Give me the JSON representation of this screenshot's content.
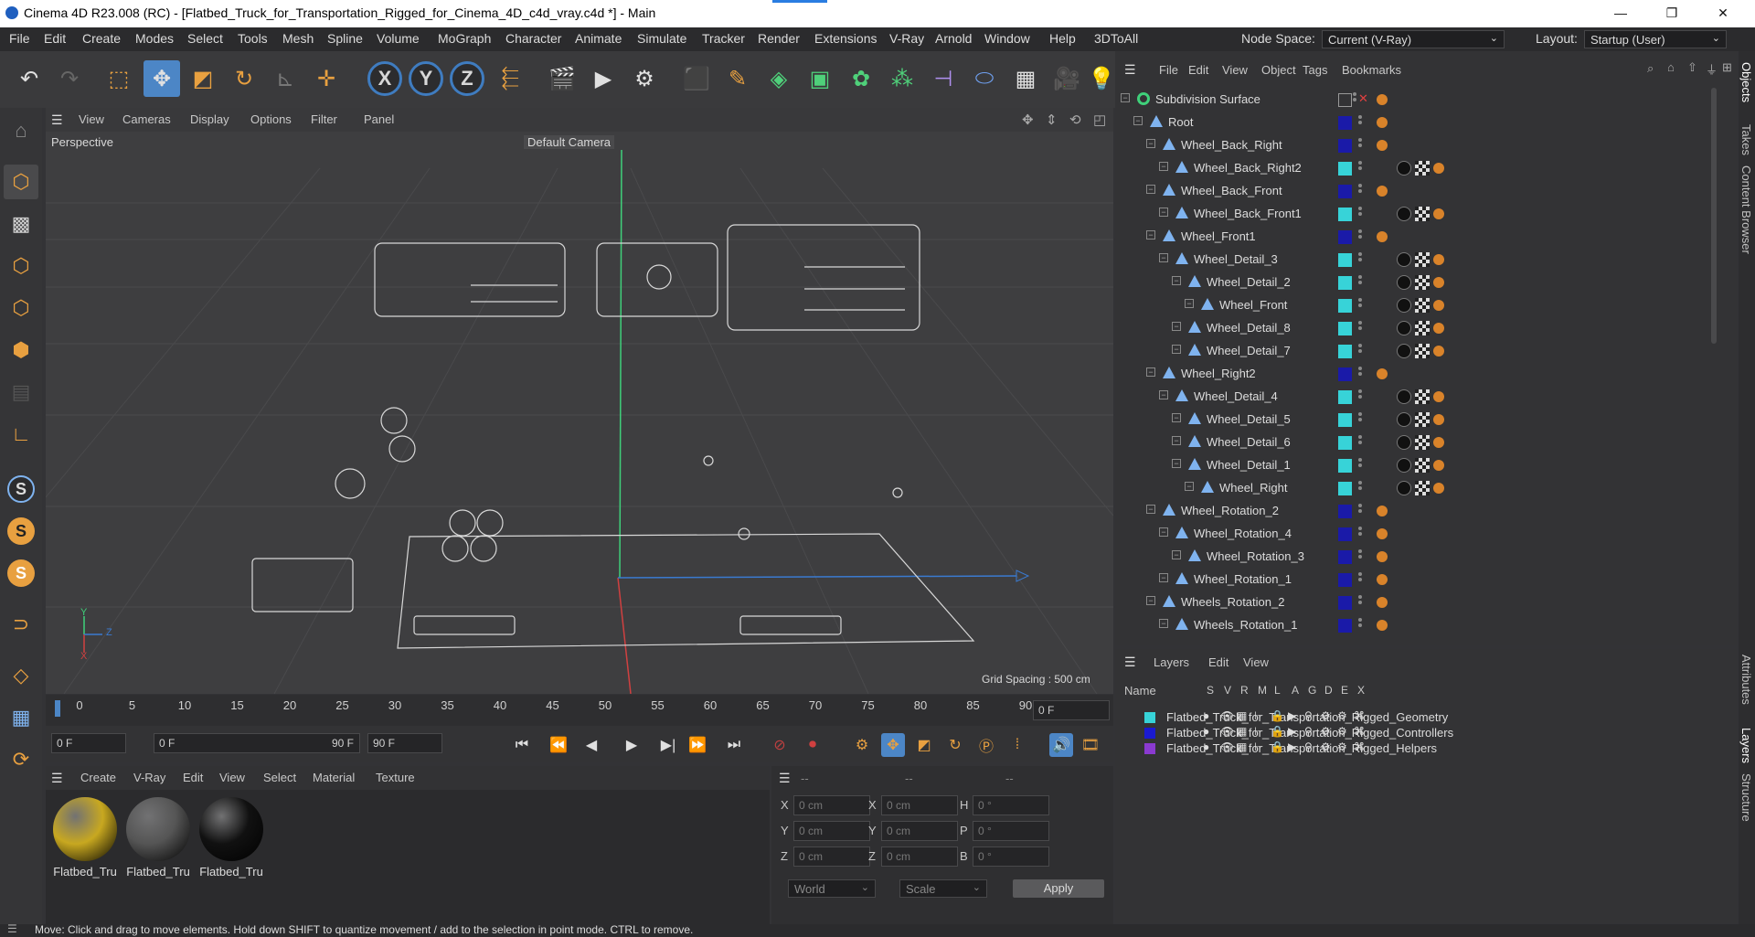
{
  "window": {
    "title": "Cinema 4D R23.008 (RC) - [Flatbed_Truck_for_Transportation_Rigged_for_Cinema_4D_c4d_vray.c4d *] - Main",
    "minimize": "—",
    "restore": "❐",
    "close": "✕"
  },
  "menubar": {
    "items": [
      "File",
      "Edit",
      "Create",
      "Modes",
      "Select",
      "Tools",
      "Mesh",
      "Spline",
      "Volume",
      "MoGraph",
      "Character",
      "Animate",
      "Simulate",
      "Tracker",
      "Render",
      "Extensions",
      "V-Ray",
      "Arnold",
      "Window",
      "Help",
      "3DToAll"
    ],
    "node_space_label": "Node Space:",
    "node_space_value": "Current (V-Ray)",
    "layout_label": "Layout:",
    "layout_value": "Startup (User)"
  },
  "viewport": {
    "menu": [
      "View",
      "Cameras",
      "Display",
      "Options",
      "Filter",
      "Panel"
    ],
    "view_name": "Perspective",
    "camera": "Default Camera",
    "grid_spacing": "Grid Spacing : 500 cm",
    "axis_y": "Y",
    "axis_z": "Z",
    "axis_x": "X"
  },
  "timeline": {
    "ticks": [
      "0",
      "5",
      "10",
      "15",
      "20",
      "25",
      "30",
      "35",
      "40",
      "45",
      "50",
      "55",
      "60",
      "65",
      "70",
      "75",
      "80",
      "85",
      "90"
    ],
    "current_frame": "0 F"
  },
  "transport": {
    "start": "0 F",
    "range_start": "0 F",
    "range_end": "90 F",
    "end": "90 F"
  },
  "materials": {
    "menu": [
      "Create",
      "V-Ray",
      "Edit",
      "View",
      "Select",
      "Material",
      "Texture"
    ],
    "items": [
      {
        "label": "Flatbed_Tru",
        "color": "#c8a820"
      },
      {
        "label": "Flatbed_Tru",
        "color": "#555555"
      },
      {
        "label": "Flatbed_Tru",
        "color": "#111111"
      }
    ]
  },
  "attributes": {
    "headers": [
      "--",
      "--",
      "--"
    ],
    "rows": [
      {
        "a": "X",
        "av": "0 cm",
        "b": "X",
        "bv": "0 cm",
        "c": "H",
        "cv": "0 °"
      },
      {
        "a": "Y",
        "av": "0 cm",
        "b": "Y",
        "bv": "0 cm",
        "c": "P",
        "cv": "0 °"
      },
      {
        "a": "Z",
        "av": "0 cm",
        "b": "Z",
        "bv": "0 cm",
        "c": "B",
        "cv": "0 °"
      }
    ],
    "coord_mode": "World",
    "scale_mode": "Scale",
    "apply": "Apply"
  },
  "status": "Move: Click and drag to move elements. Hold down SHIFT to quantize movement / add to the selection in point mode. CTRL to remove.",
  "objects": {
    "menu": [
      "File",
      "Edit",
      "View",
      "Object",
      "Tags",
      "Bookmarks"
    ],
    "rows": [
      {
        "name": "Subdivision Surface",
        "color": "",
        "depth": 0
      },
      {
        "name": "Root",
        "color": "#1a1aa8",
        "depth": 1
      },
      {
        "name": "Wheel_Back_Right",
        "color": "#1a1aa8",
        "depth": 2
      },
      {
        "name": "Wheel_Back_Right2",
        "color": "#37d3d8",
        "depth": 3
      },
      {
        "name": "Wheel_Back_Front",
        "color": "#1a1aa8",
        "depth": 2
      },
      {
        "name": "Wheel_Back_Front1",
        "color": "#37d3d8",
        "depth": 3
      },
      {
        "name": "Wheel_Front1",
        "color": "#1a1aa8",
        "depth": 2
      },
      {
        "name": "Wheel_Detail_3",
        "color": "#37d3d8",
        "depth": 3
      },
      {
        "name": "Wheel_Detail_2",
        "color": "#37d3d8",
        "depth": 4
      },
      {
        "name": "Wheel_Front",
        "color": "#37d3d8",
        "depth": 5
      },
      {
        "name": "Wheel_Detail_8",
        "color": "#37d3d8",
        "depth": 4
      },
      {
        "name": "Wheel_Detail_7",
        "color": "#37d3d8",
        "depth": 4
      },
      {
        "name": "Wheel_Right2",
        "color": "#1a1aa8",
        "depth": 2
      },
      {
        "name": "Wheel_Detail_4",
        "color": "#37d3d8",
        "depth": 3
      },
      {
        "name": "Wheel_Detail_5",
        "color": "#37d3d8",
        "depth": 4
      },
      {
        "name": "Wheel_Detail_6",
        "color": "#37d3d8",
        "depth": 4
      },
      {
        "name": "Wheel_Detail_1",
        "color": "#37d3d8",
        "depth": 4
      },
      {
        "name": "Wheel_Right",
        "color": "#37d3d8",
        "depth": 5
      },
      {
        "name": "Wheel_Rotation_2",
        "color": "#1a1aa8",
        "depth": 2
      },
      {
        "name": "Wheel_Rotation_4",
        "color": "#1a1aa8",
        "depth": 3
      },
      {
        "name": "Wheel_Rotation_3",
        "color": "#1a1aa8",
        "depth": 4
      },
      {
        "name": "Wheel_Rotation_1",
        "color": "#1a1aa8",
        "depth": 3
      },
      {
        "name": "Wheels_Rotation_2",
        "color": "#1a1aa8",
        "depth": 2
      },
      {
        "name": "Wheels_Rotation_1",
        "color": "#1a1aa8",
        "depth": 3
      }
    ]
  },
  "layers": {
    "menu": [
      "Layers",
      "Edit",
      "View"
    ],
    "col_name": "Name",
    "cols": [
      "S",
      "V",
      "R",
      "M",
      "L",
      "A",
      "G",
      "D",
      "E",
      "X"
    ],
    "rows": [
      {
        "name": "Flatbed_Truck_for_Transportation_Rigged_Geometry",
        "color": "#37d3d8"
      },
      {
        "name": "Flatbed_Truck_for_Transportation_Rigged_Controllers",
        "color": "#1a1ad0"
      },
      {
        "name": "Flatbed_Truck_for_Transportation_Rigged_Helpers",
        "color": "#8a3ad0"
      }
    ]
  },
  "side_tabs": [
    "Objects",
    "Takes",
    "Content Browser",
    "Attributes",
    "Layers",
    "Structure"
  ]
}
